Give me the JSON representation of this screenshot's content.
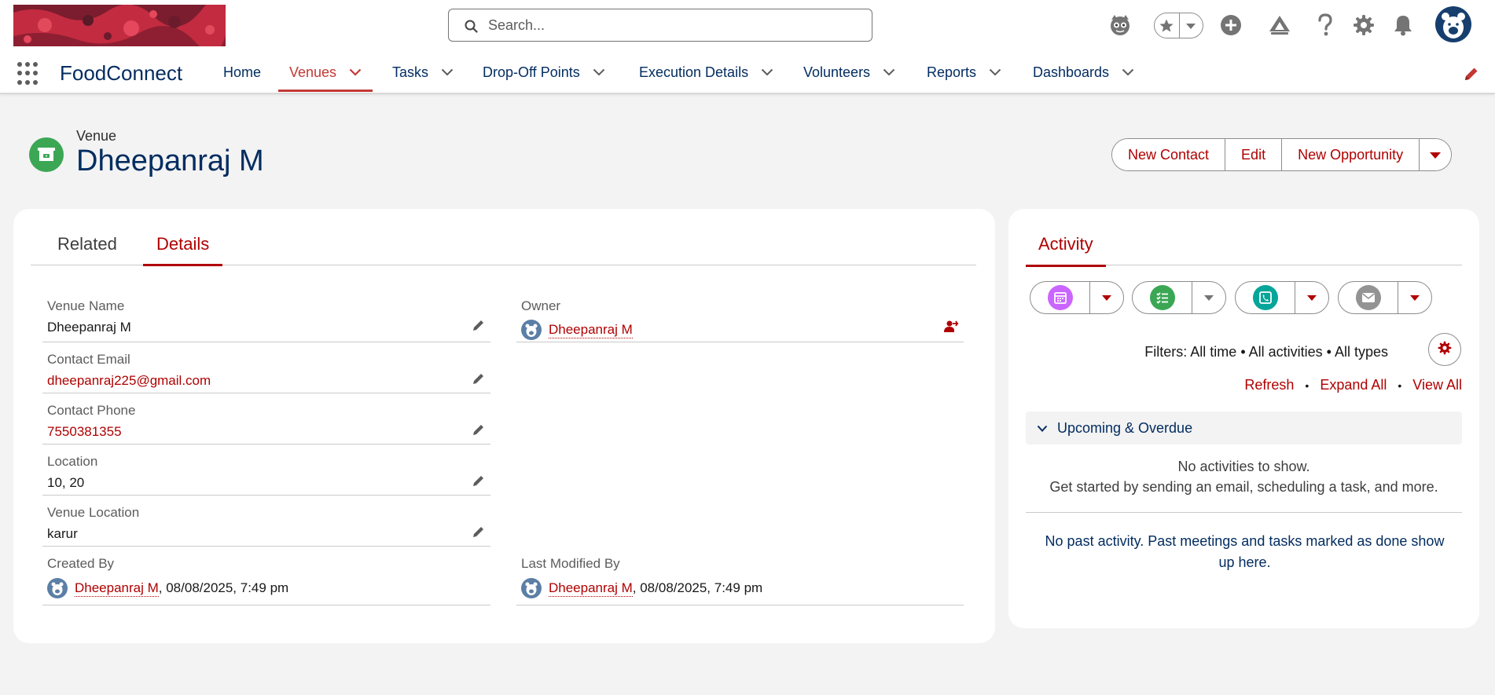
{
  "search": {
    "placeholder": "Search..."
  },
  "nav": {
    "app_name": "FoodConnect",
    "items": [
      {
        "label": "Home"
      },
      {
        "label": "Venues"
      },
      {
        "label": "Tasks"
      },
      {
        "label": "Drop-Off Points"
      },
      {
        "label": "Execution Details"
      },
      {
        "label": "Volunteers"
      },
      {
        "label": "Reports"
      },
      {
        "label": "Dashboards"
      }
    ]
  },
  "record": {
    "object_label": "Venue",
    "title": "Dheepanraj M",
    "actions": [
      "New Contact",
      "Edit",
      "New Opportunity"
    ]
  },
  "tabs": {
    "related": "Related",
    "details": "Details"
  },
  "fields": {
    "venue_name": {
      "label": "Venue Name",
      "value": "Dheepanraj M"
    },
    "owner": {
      "label": "Owner",
      "value": "Dheepanraj M"
    },
    "contact_email": {
      "label": "Contact Email",
      "value": "dheepanraj225@gmail.com"
    },
    "contact_phone": {
      "label": "Contact Phone",
      "value": "7550381355"
    },
    "location": {
      "label": "Location",
      "value": "10, 20"
    },
    "venue_location": {
      "label": "Venue Location",
      "value": "karur"
    },
    "created_by": {
      "label": "Created By",
      "user": "Dheepanraj M",
      "meta": ", 08/08/2025, 7:49 pm"
    },
    "last_modified_by": {
      "label": "Last Modified By",
      "user": "Dheepanraj M",
      "meta": ", 08/08/2025, 7:49 pm"
    }
  },
  "activity": {
    "tab": "Activity",
    "filters": "Filters: All time • All activities • All types",
    "links": {
      "refresh": "Refresh",
      "expand_all": "Expand All",
      "view_all": "View All"
    },
    "separator": "•",
    "upcoming": "Upcoming & Overdue",
    "no_activities": "No activities to show.",
    "get_started": "Get started by sending an email, scheduling a task, and more.",
    "no_past": "No past activity. Past meetings and tasks marked as done show up here."
  },
  "colors": {
    "brand_red": "#b00000",
    "navy": "#032d60",
    "venue_icon": "#3ba755",
    "event": "#cb65ff",
    "task": "#3ba755",
    "call": "#06a59a",
    "email": "#939393"
  },
  "icons": [
    "search-icon",
    "einstein-icon",
    "star-icon",
    "add-icon",
    "trailhead-icon",
    "help-icon",
    "gear-icon",
    "bell-icon",
    "avatar",
    "app-launcher-icon",
    "pencil-icon"
  ]
}
